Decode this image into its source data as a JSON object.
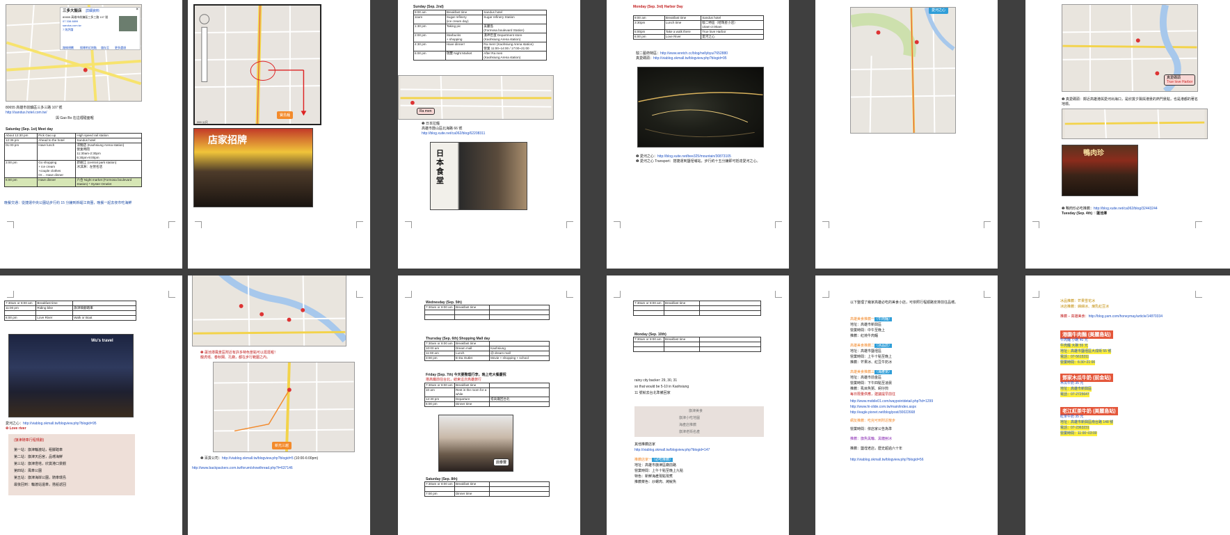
{
  "viewer": {
    "zoom_level": "multi-page"
  },
  "pages": {
    "p1": {
      "popup_title": "三多大飯店",
      "popup_link": "詳細資料",
      "popup_lines": [
        "80655 高雄市前鎮區三多三路 107 號",
        "07 338 8899",
        "sandus.com.tw",
        "7 則評論"
      ],
      "popup_actions": [
        "路線規劃",
        "搜尋附近地點",
        "儲存至",
        "更多選項"
      ],
      "address": "80655 高雄市前鎮區三多三路 107 號",
      "url": "http://sandus.hotel.com.tw/",
      "note": "與 Gao Bo 在這裡碰面喔",
      "day_header": "Saturday (Sep. 1st)  Meet day",
      "schedule": [
        [
          "About 12:30 pm",
          "Pick Gao up",
          "High speed rail station"
        ],
        [
          "12:36 pm",
          "Ahead to the hotel",
          "Sandus hotel"
        ],
        [
          "01:00 pm",
          "Have lunch",
          "涼麵店 (Kaohsiung Arena station)\n營業時間\n11:30am-2:30pm\n5:30pm-9:00pm"
        ],
        [
          "3:00 pm",
          "Go shopping\n+ ice cream\n+couple clothes\nOr… Have dinner",
          "新崛江 (central park station)\n冰淇淋：左營名店"
        ],
        [
          "6:00 pm",
          "Have dinner",
          "六合 Night market (Formosa boulevard Station) * Oyster Omelet"
        ]
      ],
      "footer": "晚餐交通：從捷運中央公園站步行約 15 分鐘到新崛江商圈，晚餐一起去夜市吃海鮮"
    },
    "p2": {
      "map_label": "寶島麵",
      "scale": "200 公尺",
      "photo_caption": "店家招牌"
    },
    "p3": {
      "day_header": "Sunday (Sep. 2nd)",
      "schedule": [
        [
          "9:00 am",
          "Breakfast time",
          "Sandus hotel"
        ],
        [
          "11am",
          "Sugar refinery\n(ice cream day)",
          "Sugar refinery Station"
        ],
        [
          "1:30 pm",
          "Taking pic",
          "美麗島\n(Formosa boulevard Station)"
        ],
        [
          "2:00 pm",
          "Starbucks\n+ shopping",
          "漢神巨蛋 Department store\n(Kaohsiung Arena station)"
        ],
        [
          "4:30 pm",
          "Have dinner!",
          "Ra men! (Kaohsiung Arena station)\n營業 11:00~14:00 / 17:00~21:00"
        ],
        [
          "6:00 pm",
          "瑞豐 Night Market",
          "After Ra men\n(Kaohsiung Arena station)"
        ]
      ],
      "map_tag": "Ra men",
      "info_title": "日本拉麵",
      "info_address": "高雄市鼓山區北海路 66 號",
      "info_url": "http://blog.xuite.net/ca062/blog/62208311",
      "photo_sign": "日本食堂"
    },
    "p4": {
      "day_header": "Monday (Sep. 3rd)  Harbor Day",
      "schedule": [
        [
          "9:00 am",
          "Breakfast time",
          "Sandus hotel"
        ],
        [
          "3:30pm",
          "Lunch time",
          "駁二特區（哈瑪星小店）\n10am-2:00am"
        ],
        [
          "5:00pm",
          "Take a walk there",
          "True love Harbor"
        ],
        [
          "6:00 pm",
          "Love River",
          "愛河之心"
        ]
      ],
      "link1_label": "駁二藝術特區：",
      "link1": "http://www.wretch.cc/blog/nellybyu/7652880",
      "link2_label": "真愛碼頭：",
      "link2": "http://viablog.okmall.tw/blogview.php?blogid=95",
      "bullet1_label": "愛河之心：",
      "bullet1": "http://blog.xuite.net/bee325/mountain/30873105",
      "bullet2": "愛河之心 Transport：搭捷運到鹽埕埔站，步行約十五分鐘即可抵達愛河之心。"
    },
    "p5": {
      "map_tag": "愛河之心"
    },
    "p6": {
      "map_tag1": "真愛碼頭",
      "map_tag2": "True love Harbor",
      "bullet": "真愛碼頭：鄰近高雄港與愛河出海口，是欣賞夕陽與港景的熱門景點，也是港都的著名地標。",
      "photo_sign": "鴨肉珍",
      "bullet2_label": "鴨肉珍必吃推薦：",
      "bullet2": "http://blog.xuite.net/ca062/blog/32443244",
      "bullet3": "Tuesday (Sep. 4th)  ♡蓮池潭"
    },
    "p7": {
      "schedule": [
        [
          "7:30am or 8:00 am",
          "Breakfast time",
          ""
        ],
        [
          "11:00 pm",
          "Riding bike",
          "旗津騎腳踏車"
        ],
        [
          "",
          "",
          ""
        ],
        [
          "6:00 pm",
          "Love River",
          "Walk or Boat"
        ]
      ],
      "photo_sign": "Wu's travel",
      "link_label": "愛河之心：",
      "link": "http://viablog.okmall.tw/blogview.php?blogid=95",
      "bullet": "Love river",
      "box_title": "(旗津騎車行程規劃)",
      "box_lines": [
        "第一站：旗津輪渡站，租腳踏車",
        "第二站：旗津天后宮，品嚐海鮮",
        "第三站：旗津燈塔，欣賞港口景觀",
        "第四站：風車公園",
        "第五站：旗津海岸公園，騎車環島",
        "最後回到：輪渡站還車，搭船返回"
      ]
    },
    "p8": {
      "map_red1": "蓮池潭風景區附近有許多特色景點可以逛逛喔！",
      "map_red2": "龍虎塔、春秋閣、孔廟，都在步行範圍之內。",
      "map_tag": "新光三越",
      "link_label": "百貨公司：",
      "link": "http://viablog.okmall.tw/blogview.php?blogid=5",
      "hours": "(10:00-6:00pm)",
      "link2": "http://www.backpackers.com.tw/forum/showthread.php?t=637146"
    },
    "p9": {
      "wed_header": "Wednesday (Sep. 5th)",
      "wed_rows": [
        [
          "7:30am or 8:00 am",
          "Breakfast time",
          ""
        ],
        [
          "",
          "",
          ""
        ],
        [
          "",
          "",
          ""
        ]
      ],
      "thu_header": "Thursday (Sep. 6th)  Shopping Mall day",
      "thu_rows": [
        [
          "7:30am or 8:00 am",
          "Breakfast time",
          ""
        ],
        [
          "10:00 am",
          "Dream mall",
          "Kaohsiung"
        ],
        [
          "11:00 am",
          "Lunch",
          "@ dream mall"
        ],
        [
          "3:00 pm",
          "E-Da Outlet",
          "Movie + shopping + school"
        ]
      ],
      "fri_header": "Friday (Sep. 7th)  今天要整理行李，晚上吃大餐慶祝",
      "fri_note": "搭高鐵前往台北，結束這次高雄旅行",
      "fri_rows": [
        [
          "7:30am or 8:00 am",
          "Breakfast time",
          ""
        ],
        [
          "10 am",
          "Rest in the room for a while",
          ""
        ],
        [
          "12:30 pm",
          "Departure",
          "搭高鐵回台北"
        ],
        [
          "6:00 pm",
          "Dinner time",
          ""
        ]
      ],
      "photo_tag": "鼎泰豐",
      "sat_header": "Saturday (Sep. 8th)",
      "sat_rows": [
        [
          "7:30am or 8:00 am",
          "Breakfast time",
          ""
        ],
        [
          "",
          "",
          ""
        ],
        [
          "7:00 pm",
          "Dinner time",
          ""
        ]
      ]
    },
    "p10": {
      "top_rows": [
        [
          "7:30am or 8:00 am",
          "Breakfast time",
          ""
        ],
        [
          "",
          "",
          ""
        ],
        [
          "",
          "",
          ""
        ]
      ],
      "mon_header": "Monday (Sep. 10th)",
      "mon_rows": [
        [
          "7:30am or 8:00 am",
          "Breakfast time",
          ""
        ],
        [
          "",
          "",
          ""
        ],
        [
          "",
          "",
          ""
        ]
      ],
      "note1": "rainy city backer: 29, 30, 31",
      "note2": "so that would be 5-10 in Kaohsiung",
      "note3": "11 號就去台北準備回家",
      "box_lines": [
        "旗津美食",
        "旗津小吃地圖",
        "海產店推薦",
        "旗津老街名產"
      ],
      "section": "其他推薦店家",
      "link": "http://viablog.okmall.tw/blogview.php?blogid=147",
      "item_label": "推薦店家一",
      "item_tag": "（必吃推薦）",
      "item_lines": [
        "地址：高雄市旗津區廟前路",
        "營業時間：上午十點至晚上九點",
        "特色：新鮮海產現點現煮",
        "推薦菜色：炒螺肉、烤魷魚"
      ]
    },
    "p11": {
      "intro": "以下整理了幾家高雄必吃的美食小店，可依照行程順路安排前往品嚐。",
      "sections": [
        {
          "label": "高雄美食推薦一",
          "tag": "（牛肉麵）",
          "lines": [
            "地址：高雄市新興區",
            "營業時間：中午至晚上",
            "推薦：紅燒牛肉麵"
          ]
        },
        {
          "label": "高雄美食推薦二",
          "tag": "（冰品店）",
          "lines": [
            "地址：高雄市鹽埕區",
            "營業時間：上午十點至晚上",
            "推薦：芒果冰、紅豆牛奶冰"
          ]
        },
        {
          "label": "高雄美食推薦三",
          "tag": "（海產粥）",
          "lines": [
            "地址：高雄市前金區",
            "營業時間：下午四點至凌晨",
            "推薦：虱目魚粥、蚵仔煎",
            "每日限量供應，建議提早前往"
          ]
        }
      ],
      "links": [
        "http://www.mobile01.com/waypointdetail.php?id=1299",
        "http://www.hi-slide.com.tw/main/index.aspx",
        "http://eagle.pixnet.net/blog/post/30022668"
      ],
      "extra": [
        "網友推薦：吃完可到附近散步",
        "營業時間：依店家公告為準",
        "推薦：旗魚黑輪、黑糖剉冰",
        "推薦：鹽埕老店，歷史超過六十年"
      ],
      "last_link": "http://viablog.okmall.tw/blogview.php?blogid=56"
    },
    "p12": {
      "top_lines": [
        "冰品推薦：芒果雪花冰",
        "冰店推薦：綿綿冰、煉乳紅豆冰"
      ],
      "link_label": "推薦 – 高雄美食：",
      "link": "http://blog.yam.com/honeymay/article/14870334",
      "blocks": [
        {
          "title": "港園牛肉麵 (美麗島站)",
          "lines": [
            "牛肉麵 小碗 40 元",
            "牛肉麵 大碗 55 元",
            "地址：高雄市鹽埕區大成街 55 號",
            "電話：07-5615311",
            "營業時間：6:30~21:00"
          ]
        },
        {
          "title": "鄧家木瓜牛奶 (前金站)",
          "lines": [
            "木瓜牛奶 35 元",
            "地址：高雄市新興區",
            "電話：07-2725647"
          ]
        },
        {
          "title": "老江紅茶牛奶 (美麗島站)",
          "lines": [
            "紅茶牛奶 35 元",
            "地址：高雄市新興區南台路 148 號",
            "電話：07-2363231",
            "營業時間：11:00~03:00"
          ]
        }
      ]
    }
  }
}
